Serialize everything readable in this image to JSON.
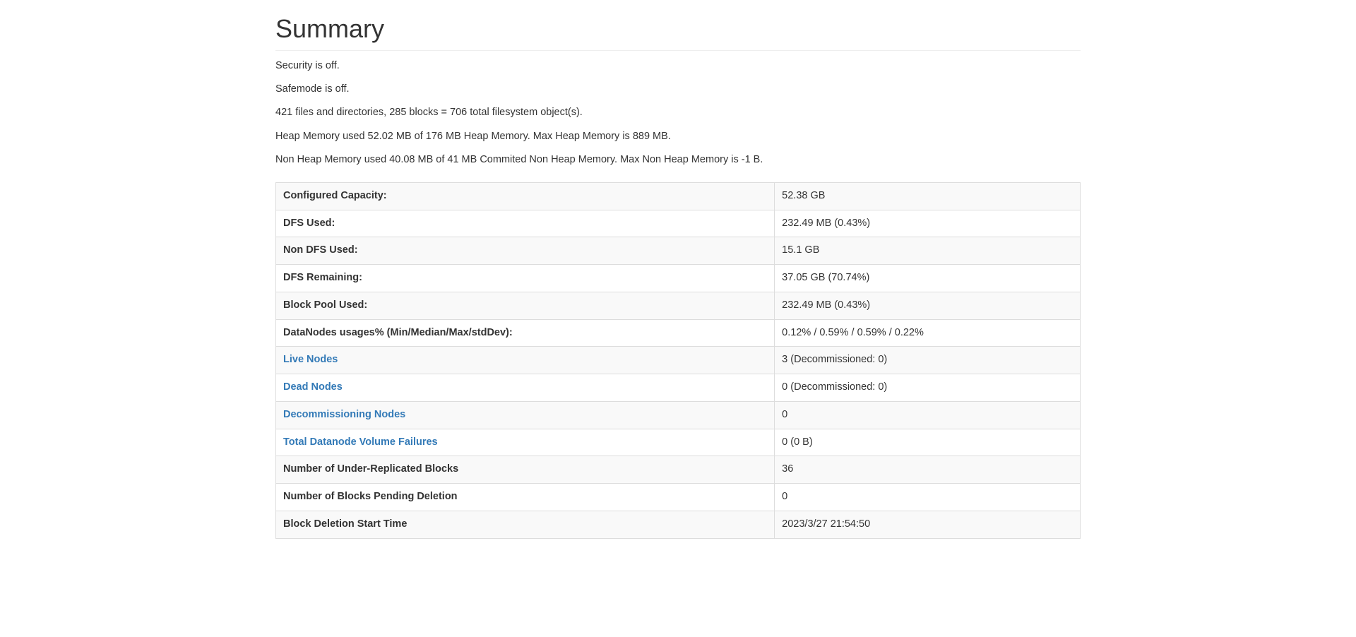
{
  "heading": "Summary",
  "paragraphs": [
    "Security is off.",
    "Safemode is off.",
    "421 files and directories, 285 blocks = 706 total filesystem object(s).",
    "Heap Memory used 52.02 MB of 176 MB Heap Memory. Max Heap Memory is 889 MB.",
    "Non Heap Memory used 40.08 MB of 41 MB Commited Non Heap Memory. Max Non Heap Memory is -1 B."
  ],
  "rows": [
    {
      "label": "Configured Capacity:",
      "value": "52.38 GB",
      "link": false
    },
    {
      "label": "DFS Used:",
      "value": "232.49 MB (0.43%)",
      "link": false
    },
    {
      "label": "Non DFS Used:",
      "value": "15.1 GB",
      "link": false
    },
    {
      "label": "DFS Remaining:",
      "value": "37.05 GB (70.74%)",
      "link": false
    },
    {
      "label": "Block Pool Used:",
      "value": "232.49 MB (0.43%)",
      "link": false
    },
    {
      "label": "DataNodes usages% (Min/Median/Max/stdDev):",
      "value": "0.12% / 0.59% / 0.59% / 0.22%",
      "link": false
    },
    {
      "label": "Live Nodes",
      "value": "3 (Decommissioned: 0)",
      "link": true
    },
    {
      "label": "Dead Nodes",
      "value": "0 (Decommissioned: 0)",
      "link": true
    },
    {
      "label": "Decommissioning Nodes",
      "value": "0",
      "link": true
    },
    {
      "label": "Total Datanode Volume Failures",
      "value": "0 (0 B)",
      "link": true
    },
    {
      "label": "Number of Under-Replicated Blocks",
      "value": "36",
      "link": false
    },
    {
      "label": "Number of Blocks Pending Deletion",
      "value": "0",
      "link": false
    },
    {
      "label": "Block Deletion Start Time",
      "value": "2023/3/27 21:54:50",
      "link": false
    }
  ]
}
